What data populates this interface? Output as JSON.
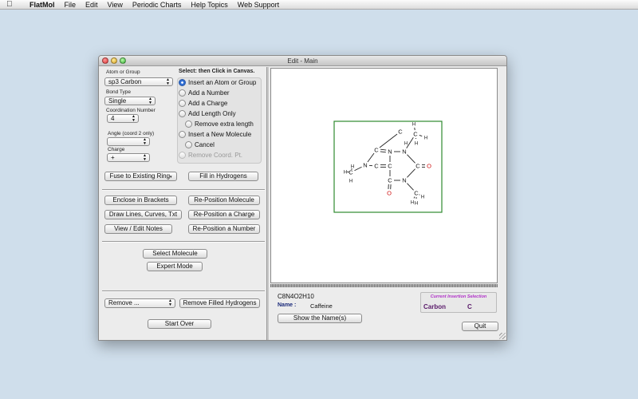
{
  "menubar": {
    "app_name": "FlatMol",
    "items": [
      "File",
      "Edit",
      "View",
      "Periodic Charts",
      "Help Topics",
      "Web Support"
    ]
  },
  "window": {
    "title": "Edit - Main"
  },
  "left_panel": {
    "atom_or_group_label": "Atom or Group",
    "atom_or_group_value": "sp3 Carbon",
    "bond_type_label": "Bond Type",
    "bond_type_value": "Single",
    "coordination_label": "Coordination Number",
    "coordination_value": "4",
    "angle_label": "Angle (coord 2 only)",
    "angle_value": "",
    "charge_label": "Charge",
    "charge_value": "+",
    "radio_heading": "Select: then Click in Canvas.",
    "radios": [
      {
        "label": "Insert an Atom or Group",
        "selected": true,
        "disabled": false
      },
      {
        "label": "Add a Number",
        "selected": false,
        "disabled": false
      },
      {
        "label": "Add a Charge",
        "selected": false,
        "disabled": false
      },
      {
        "label": "Add Length Only",
        "selected": false,
        "disabled": false
      },
      {
        "label": "Remove extra length",
        "selected": false,
        "disabled": false
      },
      {
        "label": "Insert a New Molecule",
        "selected": false,
        "disabled": false
      },
      {
        "label": "Cancel",
        "selected": false,
        "disabled": false
      },
      {
        "label": "Remove Coord. Pt.",
        "selected": false,
        "disabled": true
      }
    ],
    "fuse_label": "Fuse to Existing Ring",
    "fill_hydrogens_label": "Fill in Hydrogens",
    "enclose_label": "Enclose in Brackets",
    "reposition_molecule_label": "Re-Position Molecule",
    "draw_lines_label": "Draw Lines, Curves, Txt",
    "reposition_charge_label": "Re-Position a Charge",
    "view_notes_label": "View / Edit Notes",
    "reposition_number_label": "Re-Position a Number",
    "select_molecule_label": "Select Molecule",
    "expert_mode_label": "Expert Mode",
    "remove_value": "Remove ...",
    "remove_filled_h_label": "Remove Filled Hydrogens",
    "start_over_label": "Start Over"
  },
  "bottom_info": {
    "formula": "C8N4O2H10",
    "name_label": "Name :",
    "name_value": "Caffeine",
    "show_names_label": "Show the Name(s)",
    "selection_title": "Current Insertion Selection",
    "selection_element": "Carbon",
    "selection_symbol": "C",
    "quit_label": "Quit"
  },
  "molecule": {
    "frame_color": "#2f8a2f",
    "oxygen_color": "#d01818",
    "atom_labels": [
      "N",
      "C",
      "N",
      "C",
      "C",
      "C",
      "N",
      "C",
      "O",
      "N",
      "C",
      "O",
      "C",
      "C",
      "C",
      "H",
      "H",
      "H",
      "H",
      "H",
      "H",
      "H",
      "H",
      "H",
      "H"
    ]
  }
}
